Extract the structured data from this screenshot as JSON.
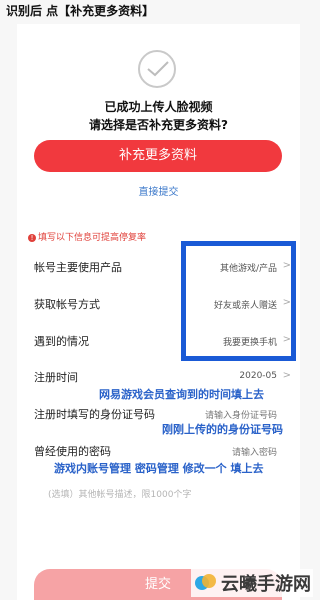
{
  "caption": "识别后 点【补充更多资料】",
  "status": {
    "line1": "已成功上传人脸视频",
    "line2": "请选择是否补充更多资料?"
  },
  "supplement_button": "补充更多资料",
  "direct_submit": "直接提交",
  "warning": {
    "icon": "!",
    "text": "填写以下信息可提高停复率"
  },
  "fields": {
    "product": {
      "label": "帐号主要使用产品",
      "value": "其他游戏/产品"
    },
    "method": {
      "label": "获取帐号方式",
      "value": "好友或亲人赠送"
    },
    "situation": {
      "label": "遇到的情况",
      "value": "我要更换手机"
    },
    "register_time": {
      "label": "注册时间",
      "value": "2020-05"
    },
    "id_number": {
      "label": "注册时填写的身份证号码",
      "placeholder": "请输入身份证号码"
    },
    "old_password": {
      "label": "曾经使用的密码",
      "placeholder": "请输入密码"
    }
  },
  "annotations": {
    "register_time": "网易游戏会员查询到的时间填上去",
    "id_number": "刚刚上传的的身份证号码",
    "password": "游戏内账号管理 密码管理 修改一个 填上去"
  },
  "description_hint": "(选填）其他帐号描述，限1000个字",
  "submit_button": "提交",
  "watermark": "云曦手游网",
  "colors": {
    "primary": "#f1393e",
    "annotation": "#2a62c9",
    "frame": "#1a5ad6"
  }
}
